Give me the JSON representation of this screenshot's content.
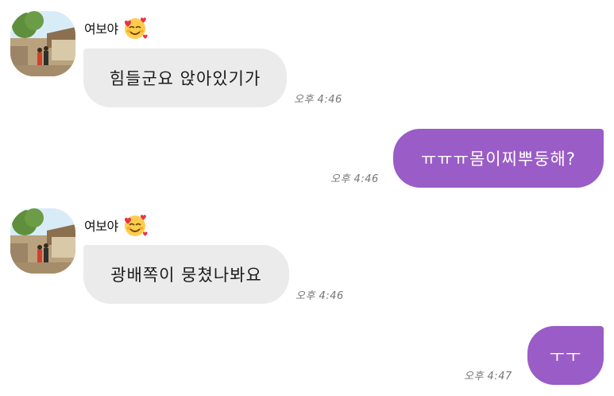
{
  "messages": [
    {
      "sender": "여보야",
      "text": "힘들군요 앉아있기가",
      "time": "오후 4:46",
      "direction": "incoming"
    },
    {
      "text": "ㅠㅠㅠ몸이찌뿌둥해?",
      "time": "오후 4:46",
      "direction": "outgoing"
    },
    {
      "sender": "여보야",
      "text": "광배쪽이 뭉쳤나봐요",
      "time": "오후 4:46",
      "direction": "incoming"
    },
    {
      "text": "ㅜㅜ",
      "time": "오후 4:47",
      "direction": "outgoing"
    }
  ],
  "colors": {
    "incoming_bubble": "#ebebeb",
    "outgoing_bubble": "#9a5cc6",
    "timestamp": "#777777"
  },
  "icons": {
    "sender_emoji": "smiling-face-with-hearts-icon",
    "avatar": "profile-photo-avatar"
  }
}
